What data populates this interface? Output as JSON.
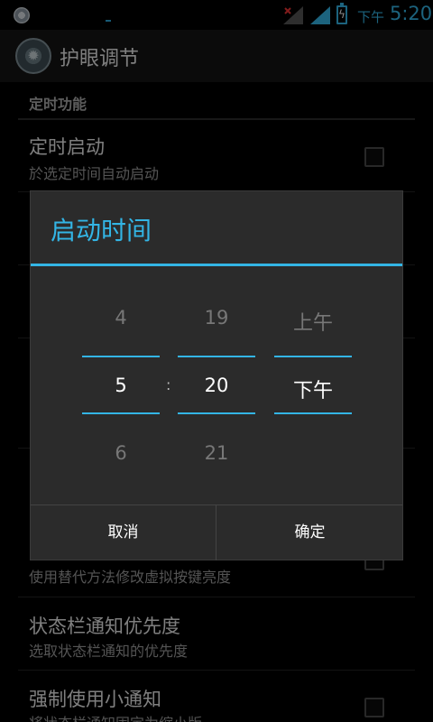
{
  "statusbar": {
    "ampm": "下午",
    "time": "5:20",
    "icons": [
      "app-notification-icon",
      "signal-icon",
      "signal-icon",
      "battery-charging-icon"
    ]
  },
  "actionbar": {
    "title": "护眼调节",
    "icon": "app-icon"
  },
  "settings": {
    "category": "定时功能",
    "items": [
      {
        "title": "定时启动",
        "summary": "於选定时间自动启动"
      },
      {
        "title": "",
        "summary": "使用替代方法修改虚拟按键亮度"
      },
      {
        "title": "状态栏通知优先度",
        "summary": "选取状态栏通知的优先度"
      },
      {
        "title": "强制使用小通知",
        "summary": "将状态栏通知固定为缩小版"
      }
    ]
  },
  "dialog": {
    "title": "启动时间",
    "hour": {
      "prev": "4",
      "current": "5",
      "next": "6"
    },
    "separator": ":",
    "minute": {
      "prev": "19",
      "current": "20",
      "next": "21"
    },
    "ampm": {
      "prev": "上午",
      "current": "下午"
    },
    "cancel_label": "取消",
    "ok_label": "确定"
  },
  "colors": {
    "accent": "#33b5e5",
    "dialog_bg": "#2b2b2b",
    "background": "#000000"
  }
}
